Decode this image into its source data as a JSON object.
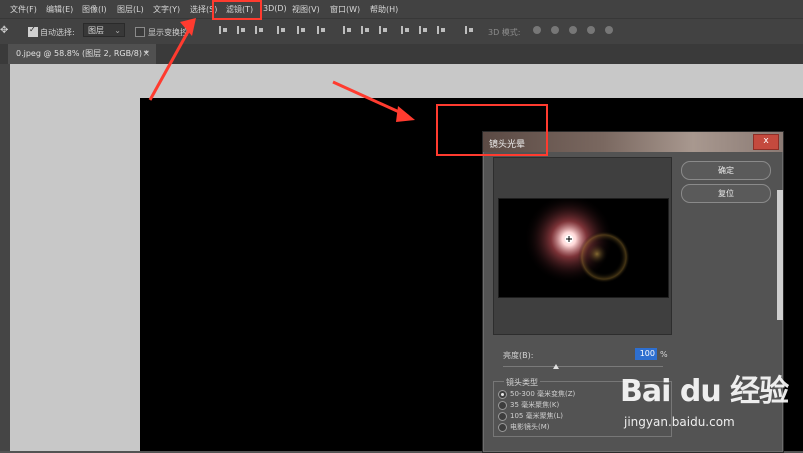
{
  "menu": {
    "items": [
      "文件(F)",
      "编辑(E)",
      "图像(I)",
      "图层(L)",
      "文字(Y)",
      "选择(S)",
      "滤镜(T)",
      "3D(D)",
      "视图(V)",
      "窗口(W)",
      "帮助(H)"
    ]
  },
  "options": {
    "auto_select_label": "自动选择:",
    "auto_select_value": "图层",
    "show_transform_label": "显示变换控",
    "mode_3d_label": "3D 模式:"
  },
  "document": {
    "tab_title": "0.jpeg @ 58.8% (图层 2, RGB/8) *",
    "close_glyph": "×"
  },
  "dialog": {
    "title": "镜头光晕",
    "close_glyph": "x",
    "ok_label": "确定",
    "reset_label": "复位",
    "brightness_label": "亮度(B):",
    "brightness_value": "100",
    "brightness_unit": "%",
    "brightness_fraction": 0.33,
    "lens_group_label": "镜头类型",
    "lens_types": [
      {
        "label": "50-300 毫米变焦(Z)",
        "selected": true
      },
      {
        "label": "35 毫米聚焦(K)",
        "selected": false
      },
      {
        "label": "105 毫米聚焦(L)",
        "selected": false
      },
      {
        "label": "电影镜头(M)",
        "selected": false
      }
    ]
  },
  "watermark": {
    "logo": "Bai du 经验",
    "url": "jingyan.baidu.com"
  },
  "colors": {
    "highlight": "#ff3b2f",
    "accent_input": "#2e6fd0"
  },
  "icons": {
    "move_tool": "move-icon",
    "align": "align-icons",
    "3d": "3d-mode-icons"
  }
}
